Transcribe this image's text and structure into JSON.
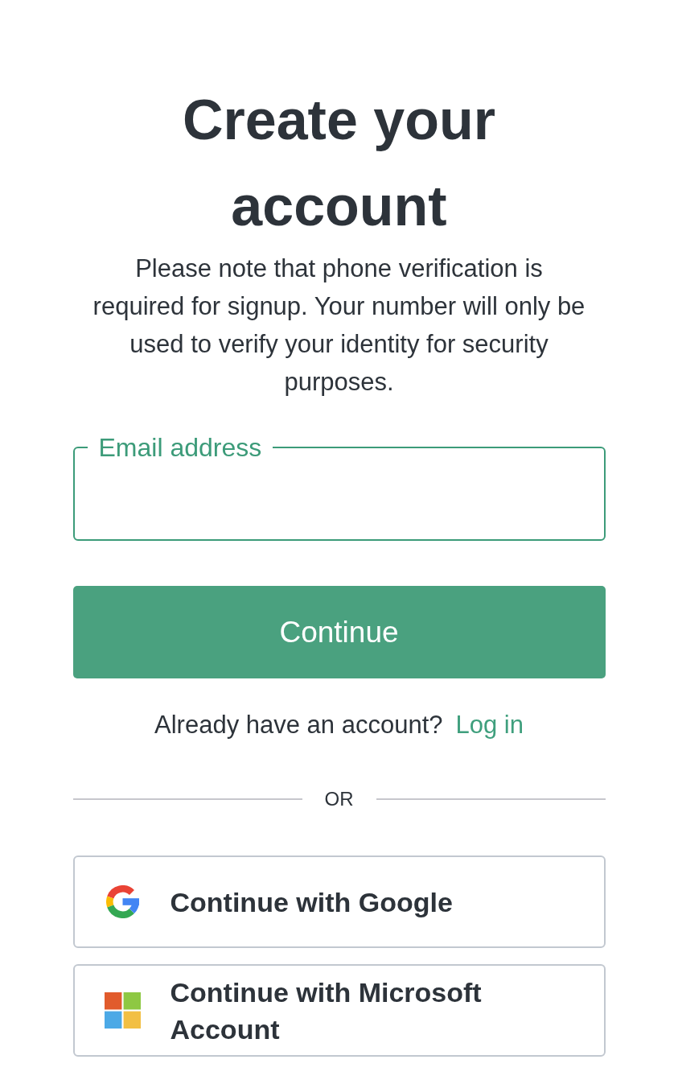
{
  "heading": "Create your account",
  "notice": "Please note that phone verification is required for signup. Your number will only be used to verify your identity for security purposes.",
  "email_field": {
    "label": "Email address",
    "focused": true
  },
  "continue_button": {
    "label": "Continue"
  },
  "login_prompt": {
    "text": "Already have an account?",
    "link": "Log in"
  },
  "divider": {
    "label": "OR"
  },
  "providers": [
    {
      "kind": "google",
      "label": "Continue with Google"
    },
    {
      "kind": "microsoft",
      "label": "Continue with Microsoft Account"
    }
  ]
}
